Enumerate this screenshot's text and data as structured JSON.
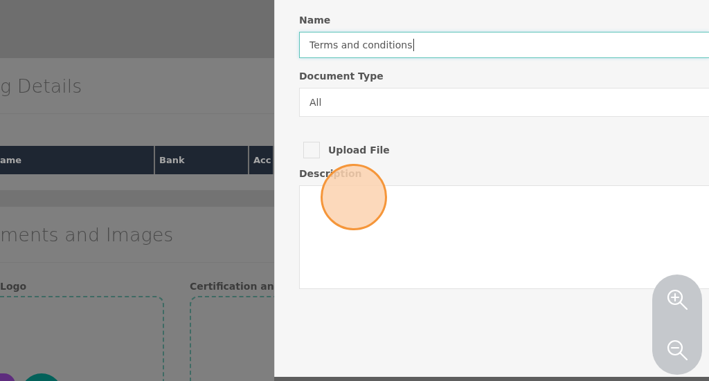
{
  "background": {
    "bank_section": {
      "title": "g Details",
      "columns": [
        "ame",
        "Bank",
        "Acc"
      ]
    },
    "documents_section": {
      "title": "ments and Images",
      "uploads": [
        {
          "label": "Logo"
        },
        {
          "label": "Certification an"
        }
      ]
    }
  },
  "form": {
    "name": {
      "label": "Name",
      "value": "Terms and conditions",
      "focused": true
    },
    "document_type": {
      "label": "Document Type",
      "value": "All"
    },
    "upload_file": {
      "label": "Upload File",
      "checked": false
    },
    "description": {
      "label": "Description"
    }
  }
}
